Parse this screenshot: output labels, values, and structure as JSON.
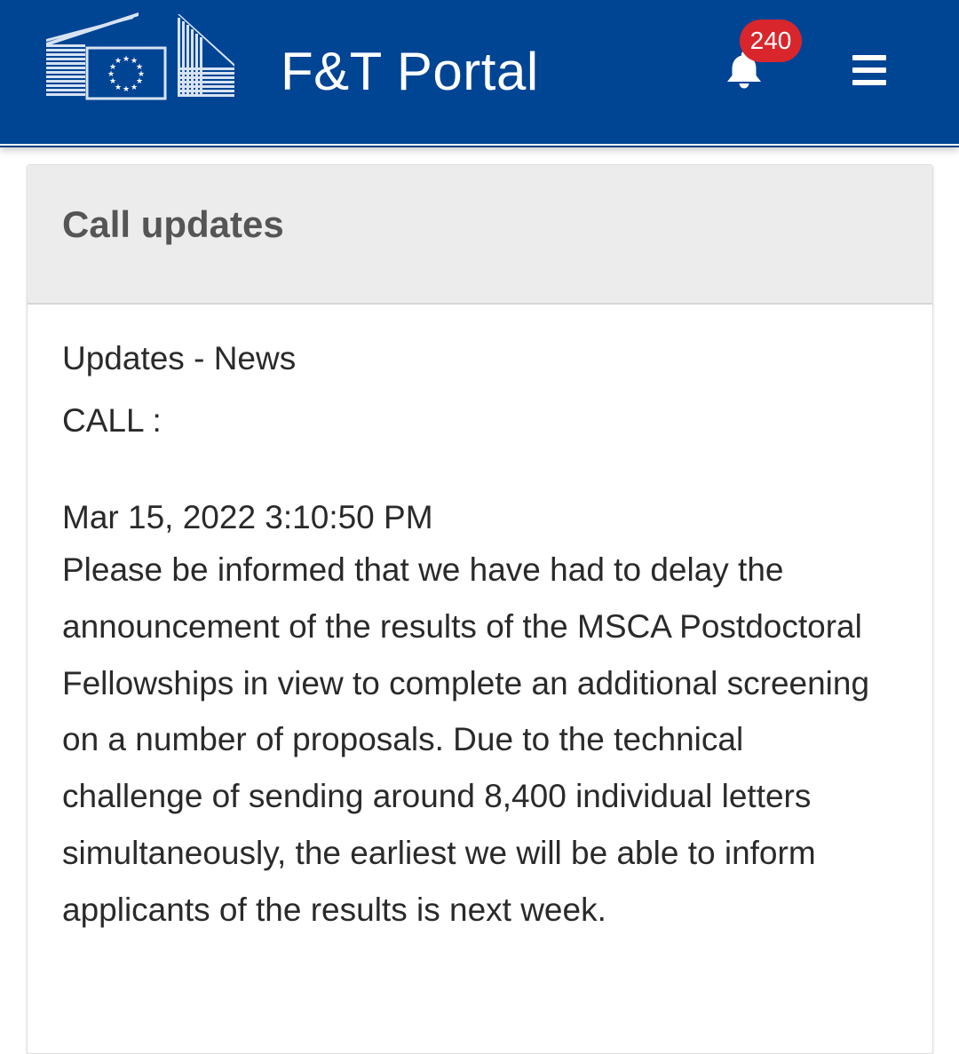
{
  "header": {
    "title": "F&T Portal",
    "notification_count": "240",
    "logo_icon": "european-commission-logo",
    "bell_icon": "bell-icon",
    "menu_icon": "hamburger-menu-icon",
    "background_color": "#004494",
    "badge_color": "#d9262d"
  },
  "panel": {
    "title": "Call updates",
    "category": "Updates - News",
    "call_label": "CALL :",
    "timestamp": "Mar 15, 2022 3:10:50 PM",
    "message": "Please be informed that we have had to delay the announcement of the results of the MSCA Postdoctoral Fellowships in view to complete an additional screening on a number of proposals. Due to the technical challenge of sending around 8,400 individual letters simultaneously, the earliest we will be able to inform applicants of the results is next week."
  }
}
